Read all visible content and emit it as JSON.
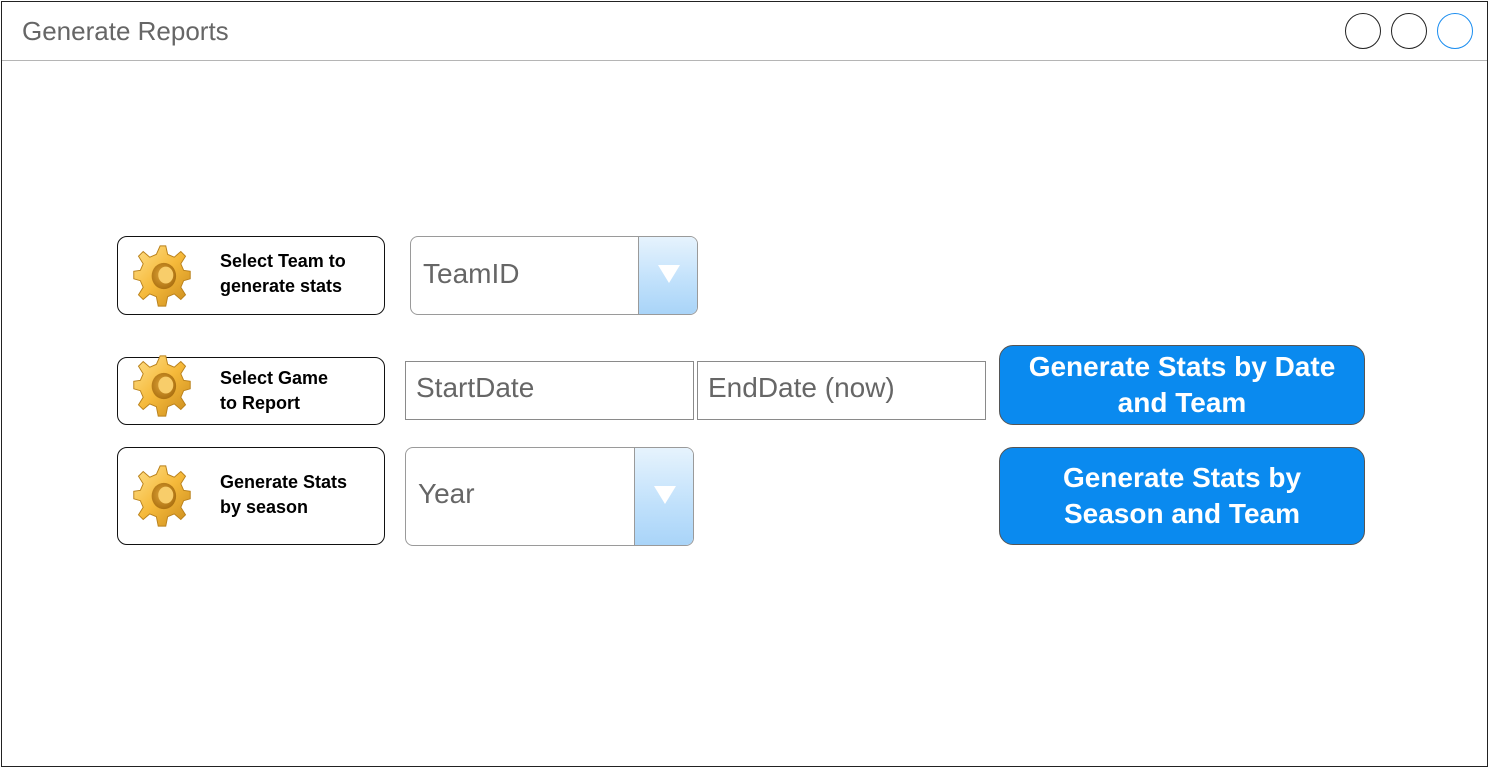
{
  "window": {
    "title": "Generate Reports",
    "controls": [
      "minimize",
      "maximize",
      "close"
    ],
    "close_color": "#1a8df0"
  },
  "rows": {
    "team": {
      "label_line1": "Select Team to",
      "label_line2": "generate stats",
      "icon": "gear-icon",
      "select_value": "TeamID"
    },
    "game": {
      "label_line1": "Select Game",
      "label_line2": "to Report",
      "icon": "gear-icon",
      "start_date": "StartDate",
      "end_date": "EndDate (now)",
      "button_line1": "Generate Stats by Date",
      "button_line2": "and Team"
    },
    "season": {
      "label_line1": "Generate Stats",
      "label_line2": "by season",
      "icon": "gear-icon",
      "select_value": "Year",
      "button_line1": "Generate Stats by",
      "button_line2": "Season and Team"
    }
  },
  "colors": {
    "accent": "#0a8aef",
    "dropdown_arrow_bg": "#bfe0fb"
  }
}
